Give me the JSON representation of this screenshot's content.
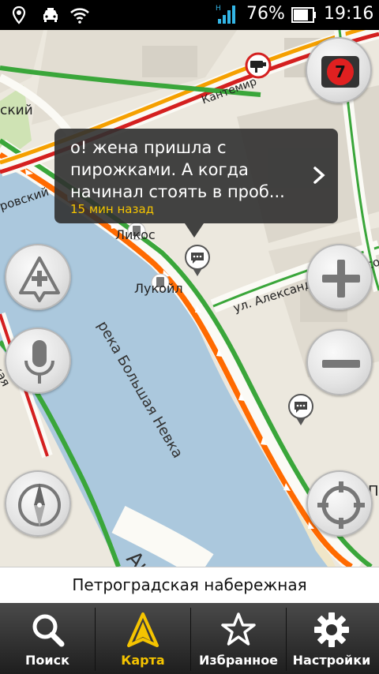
{
  "status_bar": {
    "icons": [
      "location-icon",
      "car-icon",
      "wifi-icon",
      "signal-icon",
      "battery-icon"
    ],
    "battery_percent": "76%",
    "time": "19:16"
  },
  "map": {
    "labels": {
      "district_partial": "ский",
      "street_partial_left": "ровский",
      "embankment_partial": "ская",
      "kantemir": "Кантемир",
      "matrosov": "ул. Александра Матросова",
      "river": "река Большая Невка",
      "lukoil": "Лукойл",
      "poi_partial": "Ликос",
      "avenue": "Академика",
      "edge_partial": "П"
    },
    "route_color": "#ff6a00",
    "traffic_green": "#3aa63a",
    "traffic_red": "#d42020"
  },
  "popup": {
    "message": "о! жена пришла с пирожками. А когда начинал стоять в проб...",
    "time_ago": "15 мин назад"
  },
  "traffic_level": "7",
  "street_name": "Петроградская набережная",
  "nav": [
    {
      "label": "Поиск",
      "icon": "search-icon"
    },
    {
      "label": "Карта",
      "icon": "map-arrow-icon"
    },
    {
      "label": "Избранное",
      "icon": "star-icon"
    },
    {
      "label": "Настройки",
      "icon": "gear-icon"
    }
  ]
}
